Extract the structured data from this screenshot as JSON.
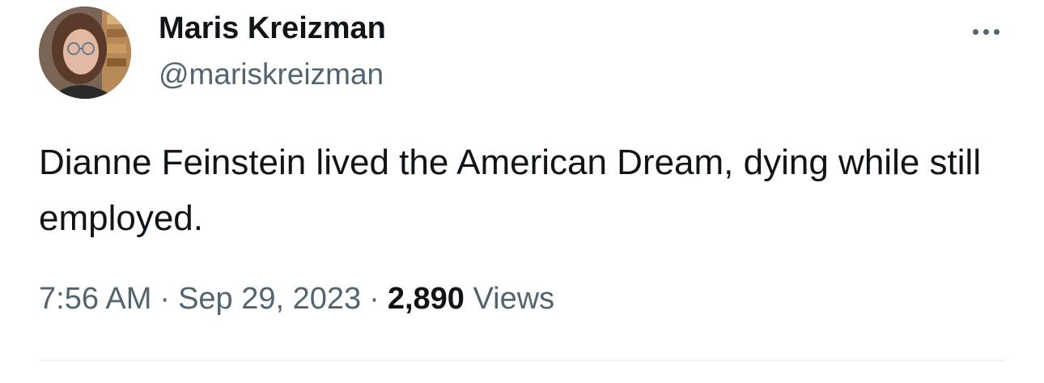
{
  "author": {
    "display_name": "Maris Kreizman",
    "handle": "@mariskreizman"
  },
  "tweet": {
    "text": "Dianne Feinstein lived the American Dream, dying while still employed.",
    "time": "7:56 AM",
    "date": "Sep 29, 2023",
    "separator": "·",
    "views_count": "2,890",
    "views_label": "Views"
  },
  "icons": {
    "more": "more-horizontal-icon"
  },
  "colors": {
    "text_primary": "#0f1419",
    "text_secondary": "#536471",
    "divider": "#eff3f4"
  }
}
